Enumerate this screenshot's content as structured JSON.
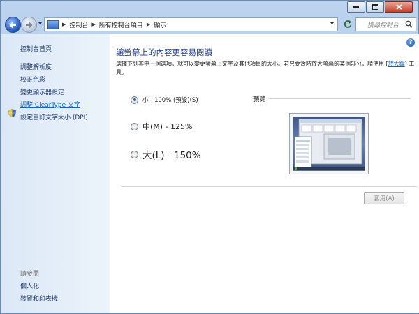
{
  "address_bar": {
    "crumbs": [
      "控制台",
      "所有控制台項目",
      "顯示"
    ]
  },
  "search": {
    "placeholder": "搜尋控制台"
  },
  "sidebar": {
    "home": "控制台首頁",
    "items": [
      {
        "label": "調整解析度"
      },
      {
        "label": "校正色彩"
      },
      {
        "label": "變更顯示器設定"
      },
      {
        "label": "調整 ClearType 文字"
      },
      {
        "label": "設定自訂文字大小 (DPI)"
      }
    ],
    "see_also_title": "請參閱",
    "see_also": [
      {
        "label": "個人化"
      },
      {
        "label": "裝置和印表機"
      }
    ]
  },
  "main": {
    "title": "讓螢幕上的內容更容易閱讀",
    "desc_before_link": "選擇下列其中一個選項，就可以變更螢幕上文字及其他項目的大小。若只要暫時放大螢幕的某個部分，請使用 [",
    "desc_link": "放大鏡",
    "desc_after_link": "] 工具。",
    "options": [
      {
        "label": "小 - 100% (預設)(S)",
        "selected": true
      },
      {
        "label": "中(M) - 125%",
        "selected": false
      },
      {
        "label": "大(L) - 150%",
        "selected": false
      }
    ],
    "preview_label": "預覽",
    "apply_label": "套用(A)",
    "help_glyph": "?"
  },
  "icons": {
    "back": "back-arrow-icon",
    "forward": "forward-arrow-icon",
    "shield": "shield-icon",
    "search": "search-icon",
    "refresh": "refresh-icon",
    "help": "help-icon"
  }
}
